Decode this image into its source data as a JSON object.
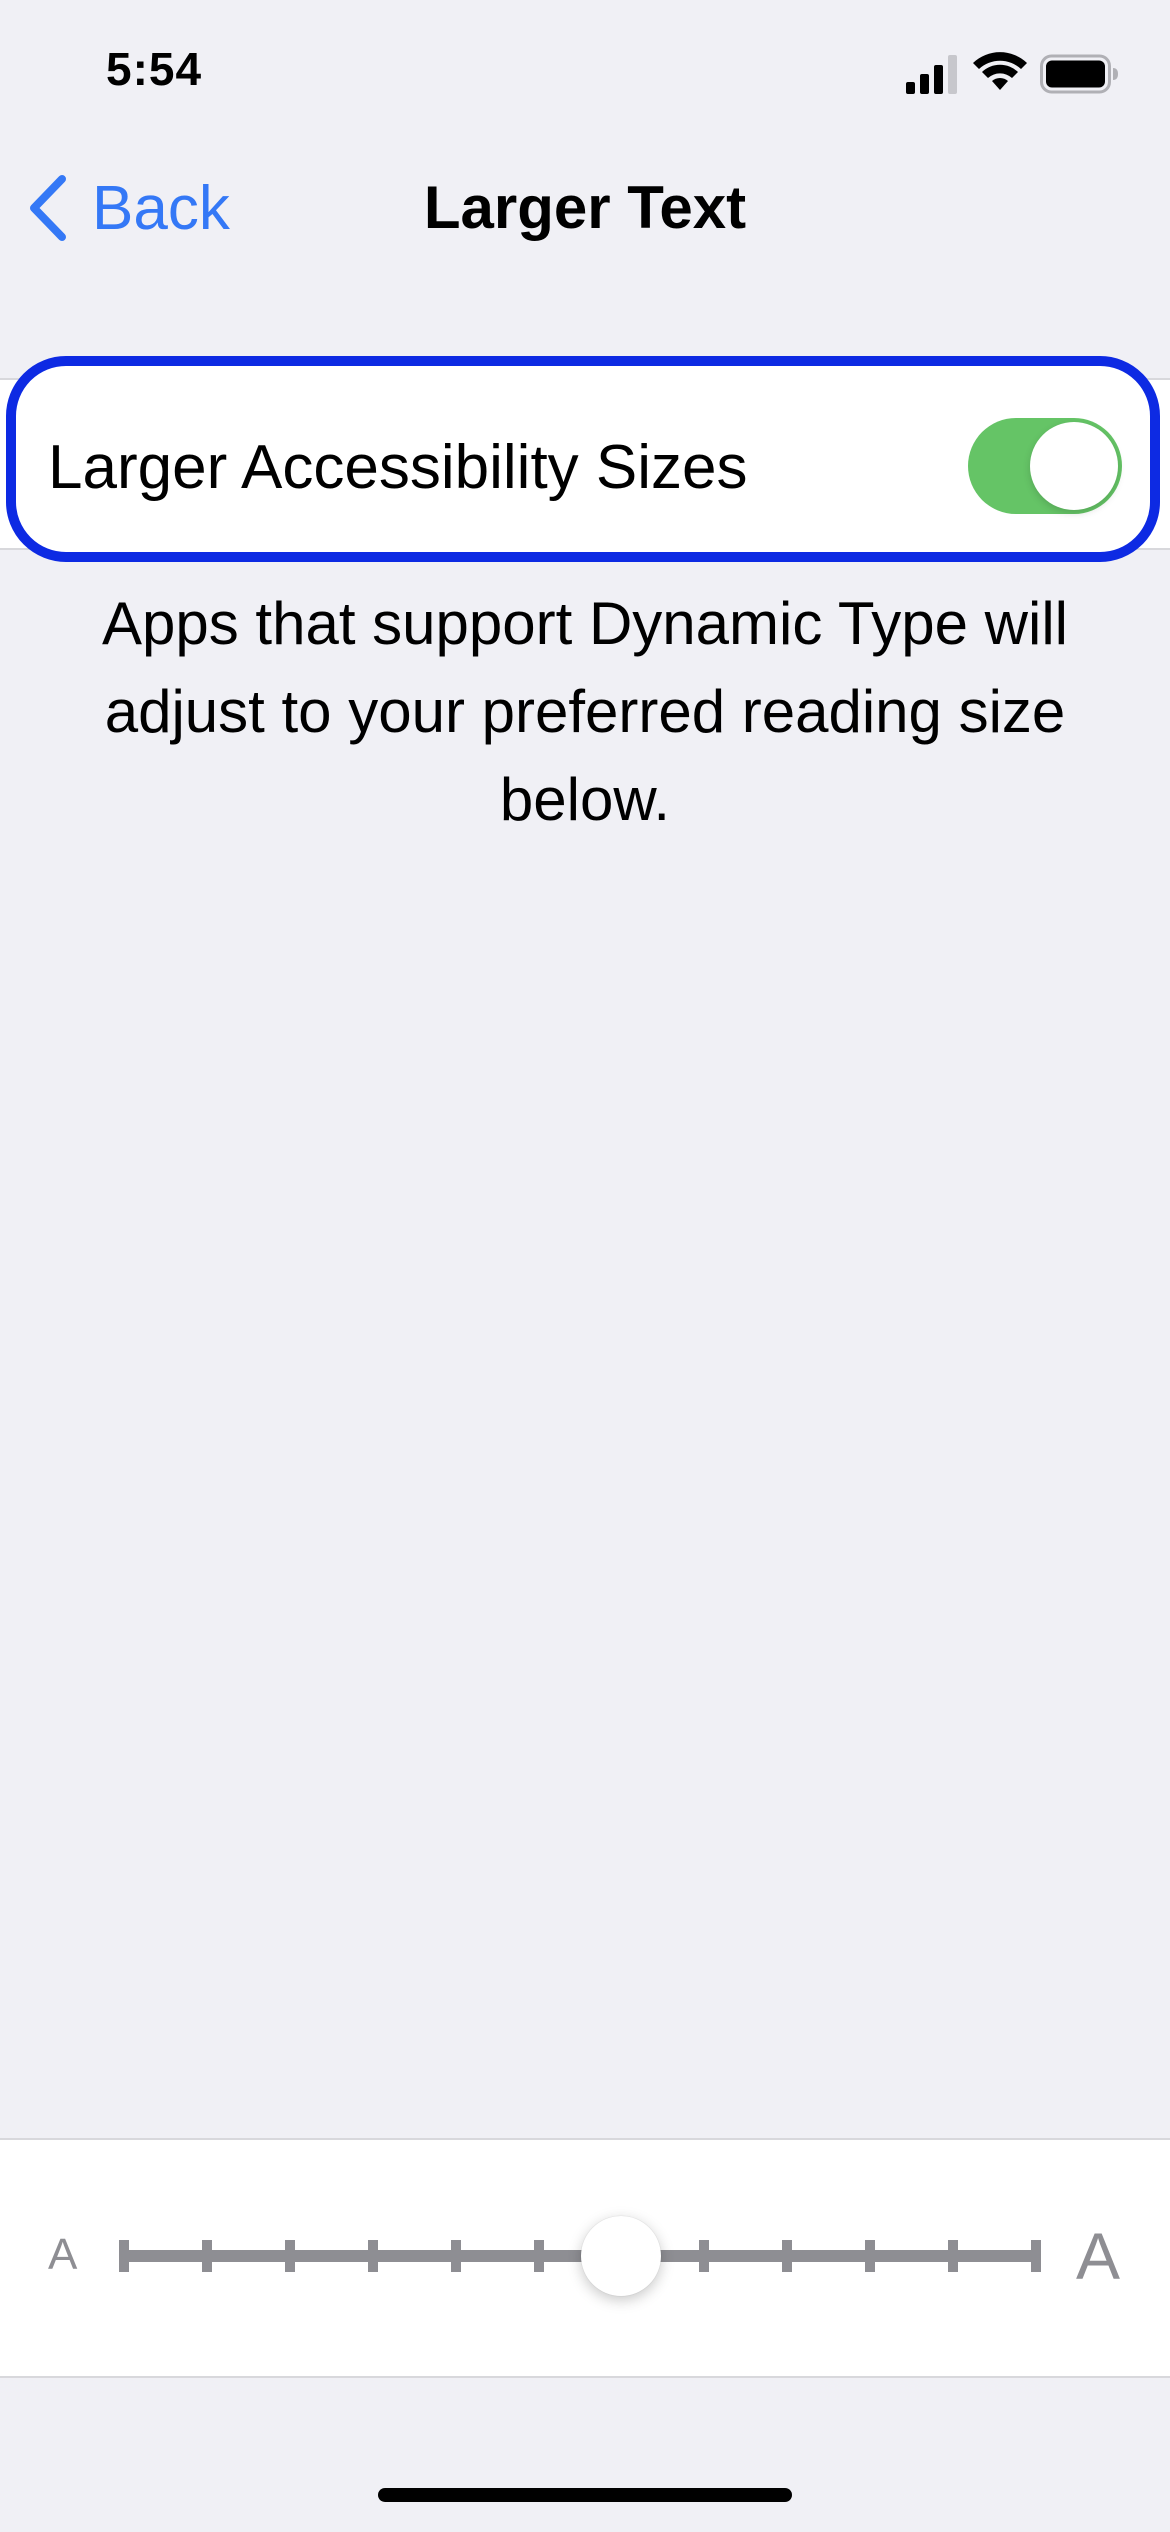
{
  "status_bar": {
    "time": "5:54",
    "icons": [
      "cellular-signal-icon",
      "wifi-icon",
      "battery-icon"
    ]
  },
  "nav": {
    "back_label": "Back",
    "title": "Larger Text"
  },
  "toggle": {
    "label": "Larger Accessibility Sizes",
    "state": "on",
    "on_color": "#65c466",
    "highlight_color": "#0d2ae3"
  },
  "description": "Apps that support Dynamic Type will adjust to your preferred reading size below.",
  "slider": {
    "min_label": "A",
    "max_label": "A",
    "steps": 12,
    "selected_step_index": 6
  },
  "colors": {
    "accent": "#3478f6",
    "background": "#f0f0f5"
  }
}
